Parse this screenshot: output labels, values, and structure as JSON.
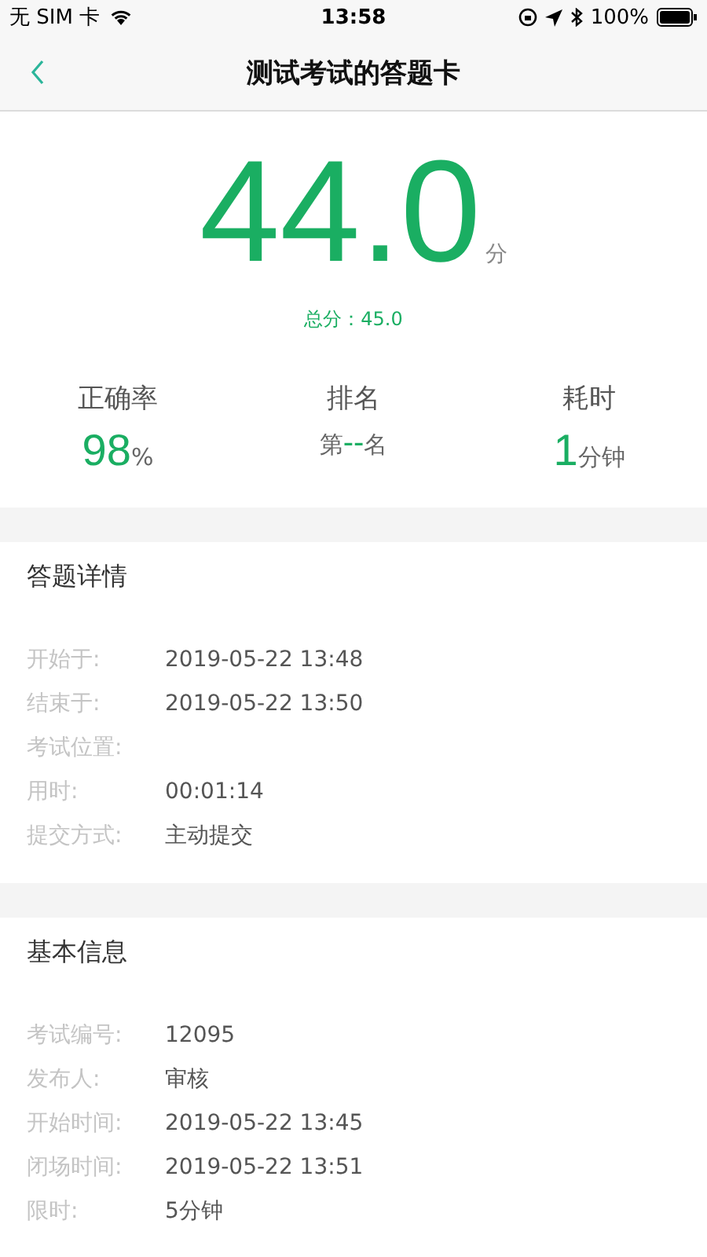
{
  "status_bar": {
    "carrier": "无 SIM 卡",
    "time": "13:58",
    "battery": "100%"
  },
  "nav": {
    "title": "测试考试的答题卡"
  },
  "score": {
    "value": "44.0",
    "unit": "分",
    "total": "总分：45.0"
  },
  "stats": [
    {
      "label": "正确率",
      "value": "98",
      "suffix": "%"
    },
    {
      "label": "排名",
      "prefix": "第",
      "value": "--",
      "suffix": "名"
    },
    {
      "label": "耗时",
      "value": "1",
      "suffix": "分钟"
    }
  ],
  "sections": [
    {
      "title": "答题详情",
      "rows": [
        {
          "label": "开始于:",
          "value": "2019-05-22 13:48"
        },
        {
          "label": "结束于:",
          "value": "2019-05-22 13:50"
        },
        {
          "label": "考试位置:",
          "value": ""
        },
        {
          "label": "用时:",
          "value": "00:01:14"
        },
        {
          "label": "提交方式:",
          "value": "主动提交"
        }
      ]
    },
    {
      "title": "基本信息",
      "rows": [
        {
          "label": "考试编号:",
          "value": "12095"
        },
        {
          "label": "发布人:",
          "value": "审核"
        },
        {
          "label": "开始时间:",
          "value": "2019-05-22 13:45"
        },
        {
          "label": "闭场时间:",
          "value": "2019-05-22 13:51"
        },
        {
          "label": "限时:",
          "value": "5分钟"
        }
      ]
    }
  ]
}
